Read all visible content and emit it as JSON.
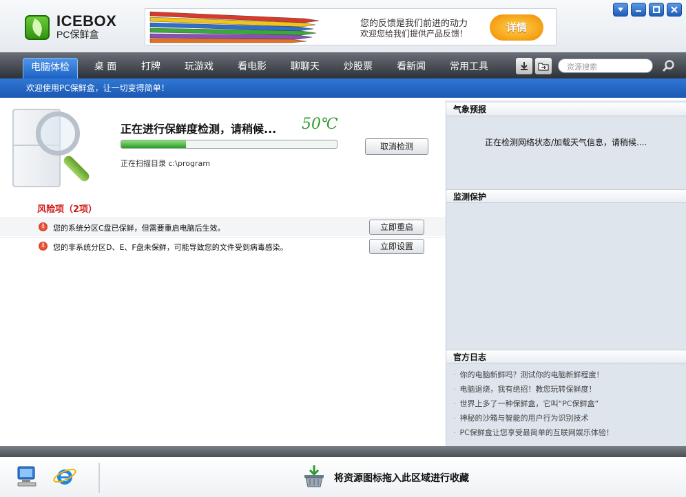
{
  "app": {
    "title": "ICEBOX",
    "subtitle": "PC保鲜盒"
  },
  "banner": {
    "line1": "您的反馈是我们前进的动力",
    "line2": "欢迎您给我们提供产品反馈！",
    "button": "详情"
  },
  "window_controls": [
    "menu-icon",
    "minimize-icon",
    "maximize-icon",
    "close-icon"
  ],
  "nav": {
    "tabs": [
      {
        "label": "电脑体检",
        "active": true
      },
      {
        "label": "桌 面"
      },
      {
        "label": "打牌"
      },
      {
        "label": "玩游戏"
      },
      {
        "label": "看电影"
      },
      {
        "label": "聊聊天"
      },
      {
        "label": "炒股票"
      },
      {
        "label": "看新闻"
      },
      {
        "label": "常用工具"
      }
    ],
    "search_placeholder": "资源搜索"
  },
  "welcome": "欢迎使用PC保鲜盒，让一切变得简单！",
  "scan": {
    "title": "正在进行保鲜度检测，请稍候...",
    "temperature": "50℃",
    "progress_percent": 30,
    "cancel_label": "取消检测",
    "path_label": "正在扫描目录",
    "path_value": "c:\\program"
  },
  "risks": {
    "title": "风险项（2项）",
    "items": [
      {
        "text": "您的系统分区C盘已保鲜，但需要重启电脑后生效。",
        "action": "立即重启"
      },
      {
        "text": "您的非系统分区D、E、F盘未保鲜，可能导致您的文件受到病毒感染。",
        "action": "立即设置"
      }
    ]
  },
  "weather": {
    "title": "气象预报",
    "message": "正在检测网络状态/加载天气信息，请稍候...."
  },
  "monitor": {
    "title": "监测保护"
  },
  "blog": {
    "title": "官方日志",
    "items": [
      "你的电脑新鲜吗？测试你的电脑新鲜程度！",
      "电脑退烧，我有绝招！教您玩转保鲜度！",
      "世界上多了一种保鲜盒，它叫“PC保鲜盒”",
      "神秘的沙箱与智能的用户行为识别技术",
      "PC保鲜盒让您享受最简单的互联网娱乐体验！"
    ]
  },
  "footer": {
    "drop_text": "将资源图标拖入此区域进行收藏",
    "icons": [
      "computer-icon",
      "ie-browser-icon",
      "download-basket-icon"
    ]
  },
  "colors": {
    "nav_active": "#1c62c4",
    "welcome_bar": "#2f78d4",
    "risk_red": "#d01818",
    "temperature_green": "#2e9a2e",
    "progress_green": "#2a9a2a"
  }
}
